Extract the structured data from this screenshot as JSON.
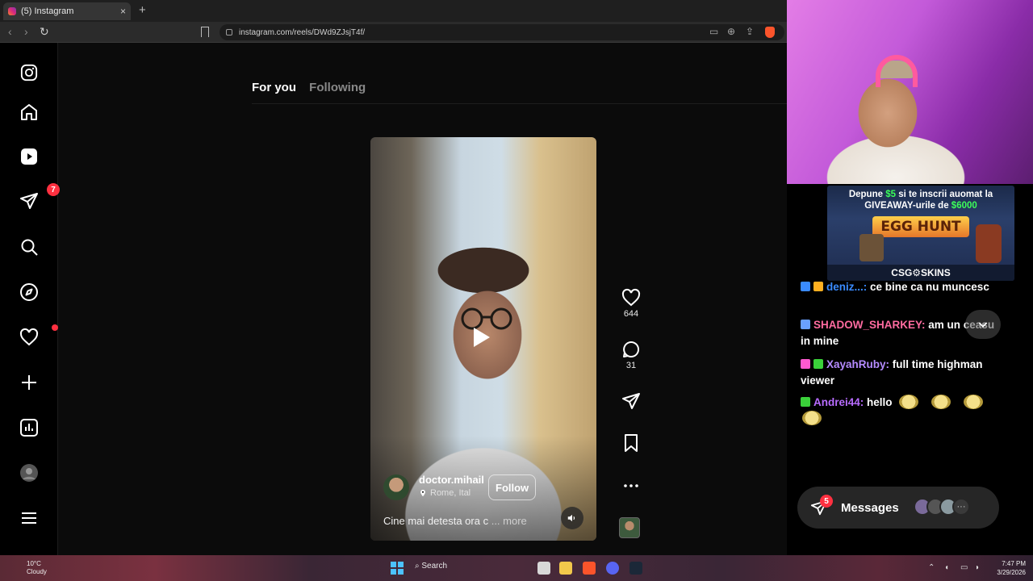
{
  "browser": {
    "tab_title": "(5) Instagram",
    "tab_close": "×",
    "new_tab": "+",
    "url": "instagram.com/reels/DWd9ZJsjT4f/"
  },
  "sidebar": {
    "notifications_badge": "7"
  },
  "feed_tabs": [
    "For you",
    "Following"
  ],
  "reel": {
    "username": "doctor.mihail",
    "location": "Rome, Ital",
    "follow_label": "Follow",
    "caption": "Cine mai detesta ora c",
    "more_label": "... more",
    "likes": "644",
    "comments": "31"
  },
  "ad": {
    "line1_pre": "Depune ",
    "line1_amount": "$5",
    "line1_post": " si te inscrii auomat la",
    "line2_pre": "GIVEAWAY-urile de ",
    "line2_amount": "$6000",
    "title": "EGG HUNT",
    "brand": "CSG⚙SKINS"
  },
  "chat": [
    {
      "user": "deniz...:",
      "text": "ce bine ca nu muncesc",
      "color": "#3a8bff"
    },
    {
      "user": "SHADOW_SHARKEY:",
      "text": "am un ceasu in mine",
      "color": "#ff6ba0"
    },
    {
      "user": "XayahRuby:",
      "text": "full time highman viewer",
      "color": "#b58bff"
    },
    {
      "user": "Andrei44:",
      "text": "hello",
      "color": "#b86cff"
    }
  ],
  "messages": {
    "label": "Messages",
    "badge": "5",
    "more": "···"
  },
  "taskbar": {
    "temp": "10°C",
    "weather": "Cloudy",
    "search": "Search",
    "time": "7:47 PM",
    "date": "3/29/2026"
  },
  "colors": {
    "instagram_red": "#ff3040",
    "ad_highlight": "#3cff5a"
  }
}
